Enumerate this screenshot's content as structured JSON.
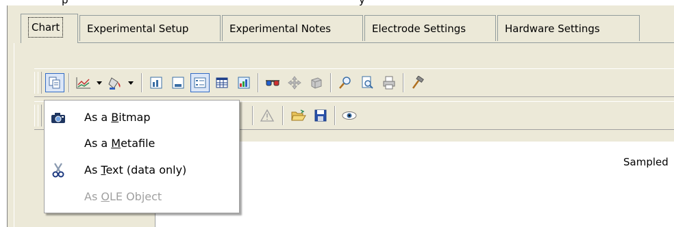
{
  "top_clipped_text": {
    "left_fragment": "p",
    "right_fragment": "y"
  },
  "tabs": [
    {
      "label": "Chart",
      "active": true
    },
    {
      "label": "Experimental Setup",
      "active": false
    },
    {
      "label": "Experimental Notes",
      "active": false
    },
    {
      "label": "Electrode Settings",
      "active": false
    },
    {
      "label": "Hardware Settings",
      "active": false
    }
  ],
  "toolbar1": {
    "buttons": [
      {
        "name": "copy-icon",
        "pressed": true
      },
      {
        "name": "line-chart-icon",
        "has_dropdown": true
      },
      {
        "name": "paint-bucket-icon",
        "has_dropdown": true
      },
      {
        "name": "chart-style-icon"
      },
      {
        "name": "chart-style-2-icon"
      },
      {
        "name": "legend-icon",
        "pressed": true
      },
      {
        "name": "data-table-icon"
      },
      {
        "name": "3d-chart-icon"
      },
      {
        "name": "3d-glasses-icon"
      },
      {
        "name": "move-icon"
      },
      {
        "name": "rotate-icon"
      },
      {
        "name": "zoom-icon"
      },
      {
        "name": "print-preview-icon"
      },
      {
        "name": "print-icon"
      },
      {
        "name": "tools-icon"
      }
    ]
  },
  "toolbar2": {
    "buttons": [
      {
        "name": "warning-icon"
      },
      {
        "name": "open-folder-icon"
      },
      {
        "name": "save-icon"
      },
      {
        "name": "view-eye-icon"
      }
    ]
  },
  "status": {
    "sampled_label": "Sampled"
  },
  "copy_menu": {
    "items": [
      {
        "prefix": "As a ",
        "accel": "B",
        "suffix": "itmap",
        "icon": "camera-icon",
        "enabled": true
      },
      {
        "prefix": "As a ",
        "accel": "M",
        "suffix": "etafile",
        "icon": "",
        "enabled": true
      },
      {
        "prefix": "As ",
        "accel": "T",
        "suffix": "ext (data only)",
        "icon": "scissors-icon",
        "enabled": true
      },
      {
        "prefix": "As ",
        "accel": "O",
        "suffix": "LE Object",
        "icon": "",
        "enabled": false
      }
    ]
  },
  "colors": {
    "panel": "#ece9d8",
    "tab_border": "#919b9c",
    "pressed_bg": "#dbe6f7",
    "pressed_border": "#316ac5",
    "disabled_text": "#a0a0a0"
  }
}
